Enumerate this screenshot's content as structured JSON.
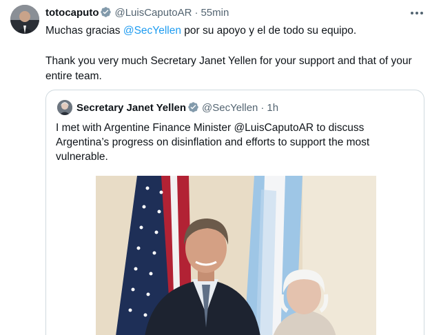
{
  "tweet": {
    "display_name": "totocaputo",
    "handle": "@LuisCaputoAR",
    "separator": "·",
    "time": "55min",
    "text_before_mention": "Muchas gracias ",
    "mention": "@SecYellen",
    "text_after_mention": " por su apoyo y el de todo su equipo.",
    "text_english": "Thank you very much Secretary Janet Yellen  for your support and that of your entire team."
  },
  "quoted_tweet": {
    "display_name": "Secretary Janet Yellen",
    "handle": "@SecYellen",
    "separator": "·",
    "time": "1h",
    "text": "I met with Argentine Finance Minister @LuisCaputoAR to discuss Argentina’s progress on disinflation and efforts to support the most vulnerable."
  },
  "colors": {
    "verified": "#829aab",
    "link": "#1d9bf0",
    "muted_text": "#536471",
    "border": "#cfd9de"
  },
  "icons": {
    "verified": "verified-badge-icon",
    "more": "more-options-icon"
  }
}
